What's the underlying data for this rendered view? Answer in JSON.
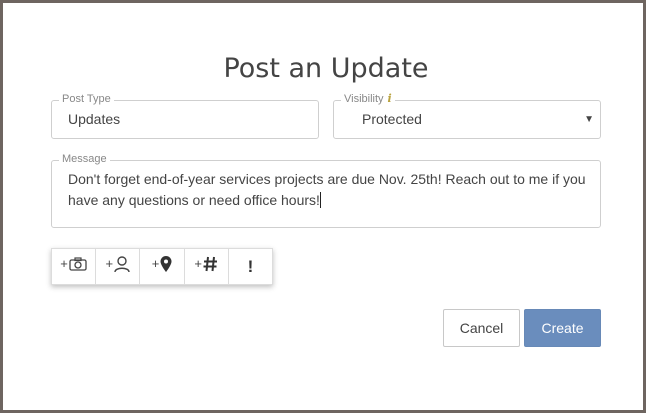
{
  "dialog": {
    "title": "Post an Update"
  },
  "post_type": {
    "label": "Post Type",
    "value": "Updates"
  },
  "visibility": {
    "label": "Visibility",
    "info_icon": "i",
    "selected": "Protected"
  },
  "message": {
    "label": "Message",
    "value": "Don't forget end-of-year services projects are due Nov. 25th! Reach out to me if you have any questions or need office hours!"
  },
  "toolbar": {
    "plus": "+",
    "important": "!",
    "icons": [
      "camera-icon",
      "person-icon",
      "location-pin-icon",
      "hashtag-icon",
      "exclamation-icon"
    ]
  },
  "actions": {
    "cancel": "Cancel",
    "create": "Create"
  },
  "colors": {
    "frame": "#6e6560",
    "primary": "#6a8dbd",
    "info": "#b9a23e"
  }
}
